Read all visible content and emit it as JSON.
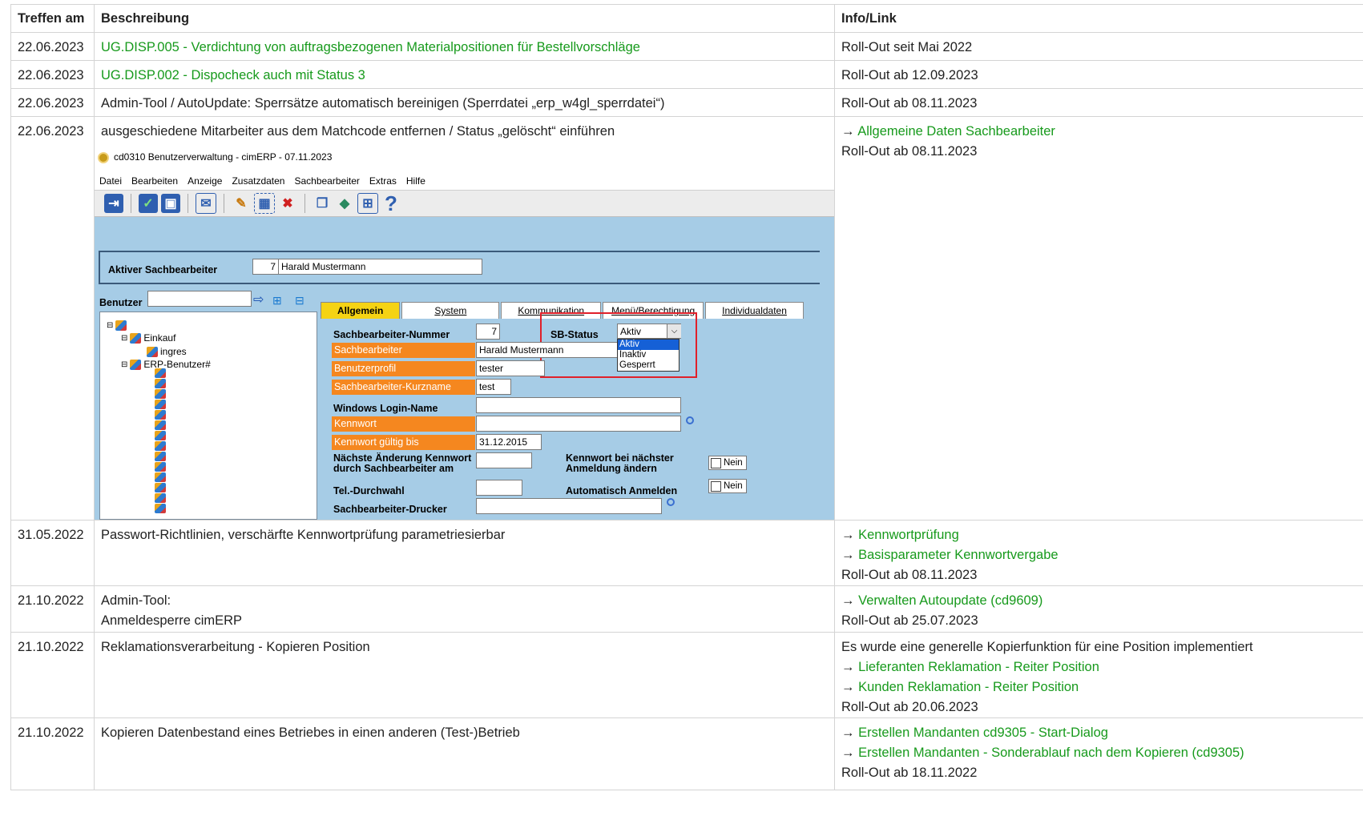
{
  "table": {
    "headers": [
      "Treffen am",
      "Beschreibung",
      "Info/Link"
    ],
    "rows": [
      {
        "date": "22.06.2023",
        "desc": "UG.DISP.005 - Verdichtung von auftragsbezogenen Materialpositionen für Bestellvorschläge",
        "info": "Roll-Out seit Mai 2022"
      },
      {
        "date": "22.06.2023",
        "desc": "UG.DISP.002 - Dispocheck auch mit Status 3",
        "info": "Roll-Out ab 12.09.2023"
      },
      {
        "date": "22.06.2023",
        "desc": "Admin-Tool / AutoUpdate: Sperrsätze automatisch bereinigen (Sperrdatei „erp_w4gl_sperrdatei“)",
        "info": "Roll-Out ab 08.11.2023"
      },
      {
        "date": "22.06.2023",
        "desc": "ausgeschiedene Mitarbeiter aus dem Matchcode entfernen / Status „gelöscht“ einführen",
        "link1": "Allgemeine Daten Sachbearbeiter",
        "info": "Roll-Out ab 08.11.2023"
      },
      {
        "date": "31.05.2022",
        "desc": "Passwort-Richtlinien, verschärfte Kennwortprüfung parametriesierbar",
        "link1": "Kennwortprüfung",
        "link2": "Basisparameter Kennwortvergabe",
        "info": "Roll-Out ab 08.11.2023"
      },
      {
        "date": "21.10.2022",
        "desc": "Admin-Tool:",
        "desc2": "Anmeldesperre cimERP",
        "link1": "Verwalten Autoupdate (cd9609)",
        "info": "Roll-Out ab 25.07.2023"
      },
      {
        "date": "21.10.2022",
        "desc": "Reklamationsverarbeitung - Kopieren Position",
        "text": "Es wurde eine generelle Kopierfunktion für eine Position implementiert",
        "link1": "Lieferanten Reklamation - Reiter Position",
        "link2": "Kunden Reklamation - Reiter Position",
        "info": "Roll-Out ab 20.06.2023"
      },
      {
        "date": "21.10.2022",
        "desc": "Kopieren Datenbestand eines Betriebes in einen anderen (Test-)Betrieb",
        "link1": "Erstellen Mandanten cd9305 - Start-Dialog",
        "link2": "Erstellen Mandanten - Sonderablauf nach dem Kopieren (cd9305)",
        "info": "Roll-Out ab 18.11.2022"
      }
    ],
    "arrow": "→"
  },
  "shot": {
    "title": "cd0310 Benutzerverwaltung - cimERP - 07.11.2023",
    "menu": [
      "Datei",
      "Bearbeiten",
      "Anzeige",
      "Zusatzdaten",
      "Sachbearbeiter",
      "Extras",
      "Hilfe"
    ],
    "active_label": "Aktiver Sachbearbeiter",
    "active_num": "7",
    "active_name": "Harald Mustermann",
    "benutzer_label": "Benutzer",
    "tree": {
      "n1": "Einkauf",
      "n2": "ingres",
      "n3": "ERP-Benutzer#"
    },
    "tabs": [
      "Allgemein",
      "System",
      "Kommunikation",
      "Menü/Berechtigung",
      "Individualdaten"
    ],
    "f_nummer_label": "Sachbearbeiter-Nummer",
    "f_nummer": "7",
    "sb_status_label": "SB-Status",
    "sb_status": "Aktiv",
    "sb_options": [
      "Aktiv",
      "Inaktiv",
      "Gesperrt"
    ],
    "f_sb_label": "Sachbearbeiter",
    "f_sb": "Harald Mustermann",
    "f_profil_label": "Benutzerprofil",
    "f_profil": "tester",
    "f_kurz_label": "Sachbearbeiter-Kurzname",
    "f_kurz": "test",
    "f_win_label": "Windows Login-Name",
    "f_kw_label": "Kennwort",
    "f_kwg_label": "Kennwort gültig bis",
    "f_kwg": "31.12.2015",
    "f_next_label1": "Nächste Änderung Kennwort",
    "f_next_label2": "durch Sachbearbeiter am",
    "f_kwn_label1": "Kennwort bei nächster",
    "f_kwn_label2": "Anmeldung ändern",
    "nein": "Nein",
    "f_tel_label": "Tel.-Durchwahl",
    "f_auto_label": "Automatisch Anmelden",
    "f_drucker_label": "Sachbearbeiter-Drucker"
  }
}
